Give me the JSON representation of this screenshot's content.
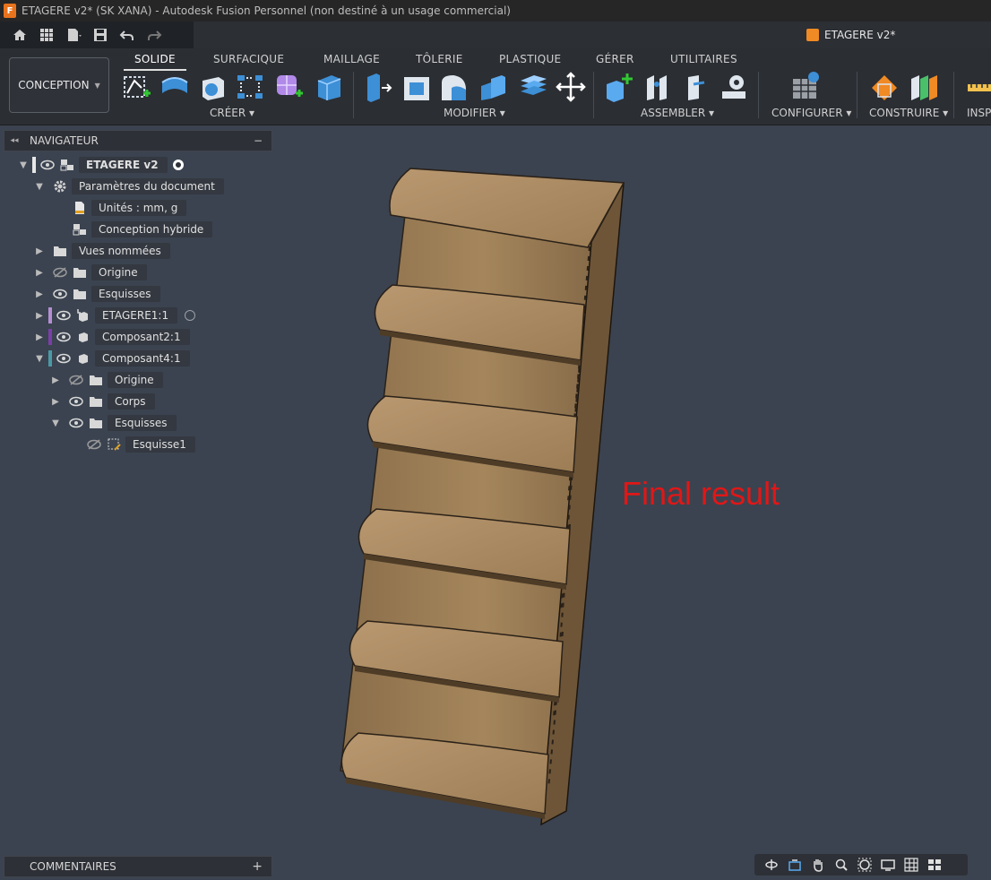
{
  "window": {
    "title": "ETAGERE v2* (SK XANA) - Autodesk Fusion Personnel (non destiné à un usage commercial)",
    "app_logo_letter": "F"
  },
  "document_tab": {
    "label": "ETAGERE v2*",
    "icon": "orange-cube-icon"
  },
  "quick_access": [
    "home-icon",
    "grid-icon",
    "file-icon",
    "save-icon",
    "undo-icon",
    "redo-icon"
  ],
  "workspace": {
    "label": "CONCEPTION"
  },
  "ribbon": {
    "tabs": [
      "SOLIDE",
      "SURFACIQUE",
      "MAILLAGE",
      "TÔLERIE",
      "PLASTIQUE",
      "GÉRER",
      "UTILITAIRES"
    ],
    "active_tab": "SOLIDE",
    "groups": [
      "CRÉER",
      "MODIFIER",
      "ASSEMBLER",
      "CONFIGURER",
      "CONSTRUIRE",
      "INSP"
    ]
  },
  "navigator": {
    "title": "NAVIGATEUR",
    "rows": [
      {
        "label": "ETAGERE v2"
      },
      {
        "label": "Paramètres du document"
      },
      {
        "label": "Unités : mm, g"
      },
      {
        "label": "Conception hybride"
      },
      {
        "label": "Vues nommées"
      },
      {
        "label": "Origine"
      },
      {
        "label": "Esquisses"
      },
      {
        "label": "ETAGERE1:1"
      },
      {
        "label": "Composant2:1"
      },
      {
        "label": "Composant4:1"
      },
      {
        "label": "Origine"
      },
      {
        "label": "Corps"
      },
      {
        "label": "Esquisses"
      },
      {
        "label": "Esquisse1"
      }
    ]
  },
  "comments": {
    "label": "COMMENTAIRES"
  },
  "viewport": {
    "annotation": "Final result"
  },
  "colors": {
    "accent_orange": "#e8731d",
    "bar_purple_light": "#b58fd1",
    "bar_purple": "#7a3fa6",
    "bar_teal": "#4a9aa5",
    "annotation_red": "#e01717"
  }
}
